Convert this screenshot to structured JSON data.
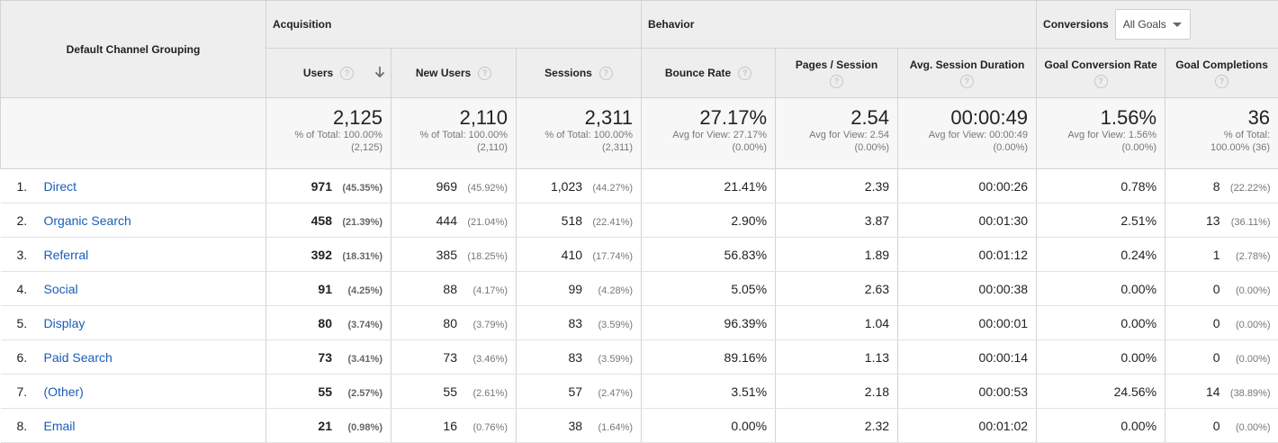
{
  "header": {
    "dimension": "Default Channel Grouping",
    "groups": {
      "acquisition": "Acquisition",
      "behavior": "Behavior",
      "conversions": "Conversions"
    },
    "goal_select": "All Goals",
    "metrics": [
      "Users",
      "New Users",
      "Sessions",
      "Bounce Rate",
      "Pages / Session",
      "Avg. Session Duration",
      "Goal Conversion Rate",
      "Goal Completions"
    ]
  },
  "totals": [
    {
      "value": "2,125",
      "line1": "% of Total: 100.00%",
      "line2": "(2,125)"
    },
    {
      "value": "2,110",
      "line1": "% of Total: 100.00%",
      "line2": "(2,110)"
    },
    {
      "value": "2,311",
      "line1": "% of Total: 100.00%",
      "line2": "(2,311)"
    },
    {
      "value": "27.17%",
      "line1": "Avg for View: 27.17%",
      "line2": "(0.00%)"
    },
    {
      "value": "2.54",
      "line1": "Avg for View: 2.54",
      "line2": "(0.00%)"
    },
    {
      "value": "00:00:49",
      "line1": "Avg for View: 00:00:49",
      "line2": "(0.00%)"
    },
    {
      "value": "1.56%",
      "line1": "Avg for View: 1.56%",
      "line2": "(0.00%)"
    },
    {
      "value": "36",
      "line1": "% of Total:",
      "line2": "100.00% (36)"
    }
  ],
  "rows": [
    {
      "idx": "1.",
      "channel": "Direct",
      "users": "971",
      "users_pct": "(45.35%)",
      "new_users": "969",
      "new_users_pct": "(45.92%)",
      "sessions": "1,023",
      "sessions_pct": "(44.27%)",
      "bounce": "21.41%",
      "pages": "2.39",
      "duration": "00:00:26",
      "conv_rate": "0.78%",
      "completions": "8",
      "completions_pct": "(22.22%)"
    },
    {
      "idx": "2.",
      "channel": "Organic Search",
      "users": "458",
      "users_pct": "(21.39%)",
      "new_users": "444",
      "new_users_pct": "(21.04%)",
      "sessions": "518",
      "sessions_pct": "(22.41%)",
      "bounce": "2.90%",
      "pages": "3.87",
      "duration": "00:01:30",
      "conv_rate": "2.51%",
      "completions": "13",
      "completions_pct": "(36.11%)"
    },
    {
      "idx": "3.",
      "channel": "Referral",
      "users": "392",
      "users_pct": "(18.31%)",
      "new_users": "385",
      "new_users_pct": "(18.25%)",
      "sessions": "410",
      "sessions_pct": "(17.74%)",
      "bounce": "56.83%",
      "pages": "1.89",
      "duration": "00:01:12",
      "conv_rate": "0.24%",
      "completions": "1",
      "completions_pct": "(2.78%)"
    },
    {
      "idx": "4.",
      "channel": "Social",
      "users": "91",
      "users_pct": "(4.25%)",
      "new_users": "88",
      "new_users_pct": "(4.17%)",
      "sessions": "99",
      "sessions_pct": "(4.28%)",
      "bounce": "5.05%",
      "pages": "2.63",
      "duration": "00:00:38",
      "conv_rate": "0.00%",
      "completions": "0",
      "completions_pct": "(0.00%)"
    },
    {
      "idx": "5.",
      "channel": "Display",
      "users": "80",
      "users_pct": "(3.74%)",
      "new_users": "80",
      "new_users_pct": "(3.79%)",
      "sessions": "83",
      "sessions_pct": "(3.59%)",
      "bounce": "96.39%",
      "pages": "1.04",
      "duration": "00:00:01",
      "conv_rate": "0.00%",
      "completions": "0",
      "completions_pct": "(0.00%)"
    },
    {
      "idx": "6.",
      "channel": "Paid Search",
      "users": "73",
      "users_pct": "(3.41%)",
      "new_users": "73",
      "new_users_pct": "(3.46%)",
      "sessions": "83",
      "sessions_pct": "(3.59%)",
      "bounce": "89.16%",
      "pages": "1.13",
      "duration": "00:00:14",
      "conv_rate": "0.00%",
      "completions": "0",
      "completions_pct": "(0.00%)"
    },
    {
      "idx": "7.",
      "channel": "(Other)",
      "users": "55",
      "users_pct": "(2.57%)",
      "new_users": "55",
      "new_users_pct": "(2.61%)",
      "sessions": "57",
      "sessions_pct": "(2.47%)",
      "bounce": "3.51%",
      "pages": "2.18",
      "duration": "00:00:53",
      "conv_rate": "24.56%",
      "completions": "14",
      "completions_pct": "(38.89%)"
    },
    {
      "idx": "8.",
      "channel": "Email",
      "users": "21",
      "users_pct": "(0.98%)",
      "new_users": "16",
      "new_users_pct": "(0.76%)",
      "sessions": "38",
      "sessions_pct": "(1.64%)",
      "bounce": "0.00%",
      "pages": "2.32",
      "duration": "00:01:02",
      "conv_rate": "0.00%",
      "completions": "0",
      "completions_pct": "(0.00%)"
    }
  ],
  "colors": {
    "header_bg": "#eeeeee",
    "link": "#1a5db8",
    "border": "#d4d4d4"
  },
  "icons": {
    "sort": "arrow-down-icon",
    "help": "question-circle-icon",
    "dropdown": "caret-down-icon"
  }
}
